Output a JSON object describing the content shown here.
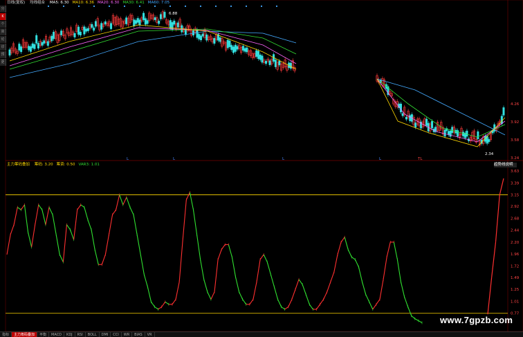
{
  "legend_top": {
    "name": "日线(复权)",
    "label": "均线组合",
    "items": [
      {
        "text": "MA5: 6.30",
        "color": "#ffffff"
      },
      {
        "text": "MA10: 6.36",
        "color": "#ffd700"
      },
      {
        "text": "MA20: 6.30",
        "color": "#ff66ff"
      },
      {
        "text": "MA30: 6.41",
        "color": "#33dd33"
      },
      {
        "text": "MA60: 7.05",
        "color": "#44aaff"
      }
    ]
  },
  "legend_bottom": {
    "name": "主力筹码叠加",
    "items": [
      {
        "text": "筹码: 3.20",
        "color": "#ffd700"
      },
      {
        "text": "筹资: 0.50",
        "color": "#ffd700"
      },
      {
        "text": "VAR3: 1.01",
        "color": "#33dd33"
      }
    ]
  },
  "price_high_label": "6.88",
  "price_low_label": "2.34",
  "right_top_label": "趋势线说明",
  "watermark": "www.7gpzb.com",
  "sidebar": [
    "分时",
    "K线",
    "个股",
    "资料",
    "论坛",
    "诊股",
    "预警",
    "更多"
  ],
  "tabs": [
    "指标",
    "主力筹码叠加",
    "平衡",
    "MACD",
    "KDJ",
    "RSI",
    "BOLL",
    "DMI",
    "CCI",
    "WR",
    "BIAS",
    "VR"
  ],
  "chart_data": [
    {
      "type": "line",
      "title": "",
      "price_axis_labels": [
        "4.26",
        "3.92",
        "3.58",
        "3.24"
      ],
      "marker_labels": [
        "L",
        "L",
        "L",
        "L",
        "TL"
      ]
    },
    {
      "type": "line",
      "title": "",
      "yticks": [
        3.63,
        3.39,
        3.15,
        2.92,
        2.68,
        2.44,
        2.2,
        1.96,
        1.72,
        1.49,
        1.25,
        1.01,
        0.77
      ],
      "ylim": [
        0.53,
        3.7
      ],
      "upper_level": 3.15,
      "lower_level": 0.77,
      "series": [
        {
          "values": [
            1.95,
            2.35,
            2.55,
            2.9,
            2.85,
            2.95,
            2.4,
            2.1,
            2.55,
            2.95,
            2.85,
            2.55,
            2.9,
            2.75,
            2.35,
            1.95,
            1.8,
            2.55,
            2.45,
            2.25,
            2.85,
            2.95,
            2.9,
            2.65,
            2.45,
            2.05,
            1.75,
            1.75,
            1.95,
            2.35,
            2.75,
            2.85,
            3.15,
            2.95,
            3.1,
            2.9,
            2.75,
            2.35,
            1.95,
            1.55,
            1.3,
            1.0,
            0.9,
            0.85,
            0.9,
            1.0,
            0.95,
            0.95,
            1.05,
            1.4,
            2.25,
            3.05,
            3.2,
            2.85,
            2.35,
            1.85,
            1.45,
            1.2,
            1.05,
            1.2,
            1.85,
            2.05,
            2.15,
            2.15,
            1.9,
            1.5,
            1.2,
            1.05,
            0.95,
            0.95,
            1.05,
            1.4,
            1.85,
            1.95,
            1.8,
            1.55,
            1.3,
            1.05,
            0.9,
            0.85,
            0.9,
            1.05,
            1.25,
            1.45,
            1.35,
            1.15,
            0.95,
            0.85,
            0.85,
            0.95,
            1.05,
            1.2,
            1.4,
            1.6,
            1.95,
            2.2,
            2.3,
            2.05,
            1.9,
            1.85,
            1.7,
            1.4,
            1.15,
            1.0,
            0.85,
            0.95,
            1.05,
            1.45,
            1.9,
            2.2,
            2.2,
            1.85,
            1.4,
            1.1,
            0.9,
            0.72,
            0.66,
            0.62,
            0.58
          ]
        },
        {
          "values": [
            0.75,
            1.5,
            2.2,
            3.15,
            3.48
          ]
        }
      ]
    }
  ]
}
